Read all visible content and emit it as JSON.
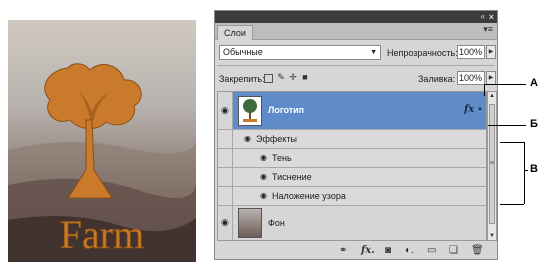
{
  "artwork": {
    "logo_text": "Farm"
  },
  "panel": {
    "title_controls": {
      "collapse": "collapse-icon",
      "close": "close-icon"
    },
    "tab_label": "Слои",
    "blend_mode": "Обычные",
    "opacity_label": "Непрозрачность:",
    "opacity_value": "100%",
    "lock_label": "Закрепить:",
    "fill_label": "Заливка:",
    "fill_value": "100%",
    "layers": [
      {
        "name": "Логотип",
        "selected": true,
        "has_fx": true,
        "fx_label": "fx"
      },
      {
        "name": "Фон",
        "selected": false
      }
    ],
    "effects_header": "Эффекты",
    "effects": [
      "Тень",
      "Тиснение",
      "Наложение узора"
    ],
    "bottom_icons": [
      "link-icon",
      "fx-icon",
      "mask-icon",
      "adjustment-icon",
      "group-folder-icon",
      "new-layer-icon",
      "trash-icon"
    ],
    "bottom_fx_label": "fx."
  },
  "callouts": {
    "a": "А",
    "b": "Б",
    "c": "В"
  },
  "colors": {
    "selected_row": "#5f8cc9",
    "panel_bg": "#d6d6d6",
    "logo_orange": "#c97a2a"
  }
}
